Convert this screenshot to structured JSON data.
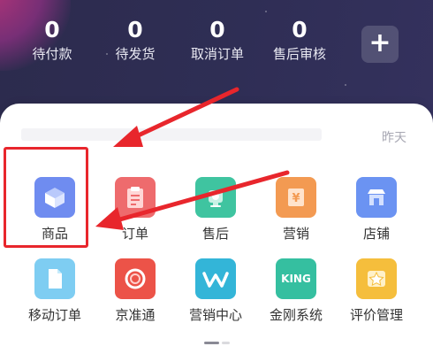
{
  "stats": [
    {
      "value": "0",
      "label": "待付款"
    },
    {
      "value": "0",
      "label": "待发货"
    },
    {
      "value": "0",
      "label": "取消订单"
    },
    {
      "value": "0",
      "label": "售后审核"
    }
  ],
  "plus_button": {
    "label": "+"
  },
  "panel": {
    "date_label": "昨天"
  },
  "grid_row1": [
    {
      "label": "商品",
      "icon": "product-box-icon",
      "color": "#6f8cf0"
    },
    {
      "label": "订单",
      "icon": "order-clipboard-icon",
      "color": "#ee6b6d"
    },
    {
      "label": "售后",
      "icon": "after-sales-headset-icon",
      "color": "#3fc4a0"
    },
    {
      "label": "营销",
      "icon": "marketing-coupon-icon",
      "color": "#f39a52"
    },
    {
      "label": "店铺",
      "icon": "store-icon",
      "color": "#6b93f2"
    }
  ],
  "grid_row2": [
    {
      "label": "移动订单",
      "icon": "mobile-order-document-icon",
      "color": "#7ecdf2"
    },
    {
      "label": "京准通",
      "icon": "jingzhuntong-ring-icon",
      "color": "#ec5348"
    },
    {
      "label": "营销中心",
      "icon": "marketing-center-wave-icon",
      "color": "#33b5d8"
    },
    {
      "label": "金刚系统",
      "icon": "king-system-icon",
      "color": "#35bfa0",
      "text": "KING"
    },
    {
      "label": "评价管理",
      "icon": "review-star-icon",
      "color": "#f5be3c"
    }
  ],
  "colors": {
    "highlight": "#e8262c",
    "arrow": "#e8262c"
  }
}
